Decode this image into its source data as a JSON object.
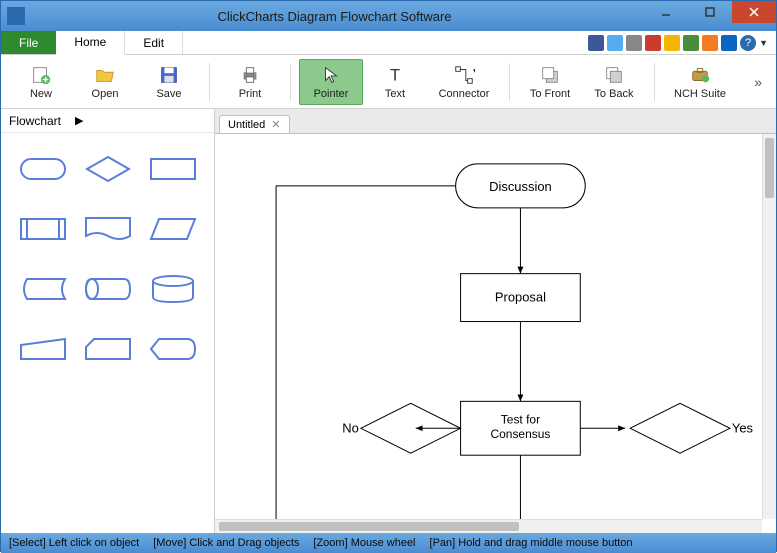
{
  "window": {
    "title": "ClickCharts Diagram Flowchart Software"
  },
  "menu": {
    "file": "File",
    "home": "Home",
    "edit": "Edit"
  },
  "toolbar": {
    "new": "New",
    "open": "Open",
    "save": "Save",
    "print": "Print",
    "pointer": "Pointer",
    "text": "Text",
    "connector": "Connector",
    "to_front": "To Front",
    "to_back": "To Back",
    "nch_suite": "NCH Suite"
  },
  "shapes": {
    "category": "Flowchart"
  },
  "document": {
    "tab_name": "Untitled"
  },
  "flowchart": {
    "discussion": "Discussion",
    "proposal": "Proposal",
    "test": "Test for\nConsensus",
    "no": "No",
    "yes": "Yes"
  },
  "status": {
    "select_label": "[Select]",
    "select_text": "Left click on object",
    "move_label": "[Move]",
    "move_text": "Click and Drag objects",
    "zoom_label": "[Zoom]",
    "zoom_text": "Mouse wheel",
    "pan_label": "[Pan]",
    "pan_text": "Hold and drag middle mouse button"
  },
  "social_colors": [
    "#3b5998",
    "#55acee",
    "#888",
    "#cc3b2f",
    "#f4b400",
    "#4a8c3b",
    "#f47c20",
    "#0a66c2",
    "#2a6bb0"
  ]
}
